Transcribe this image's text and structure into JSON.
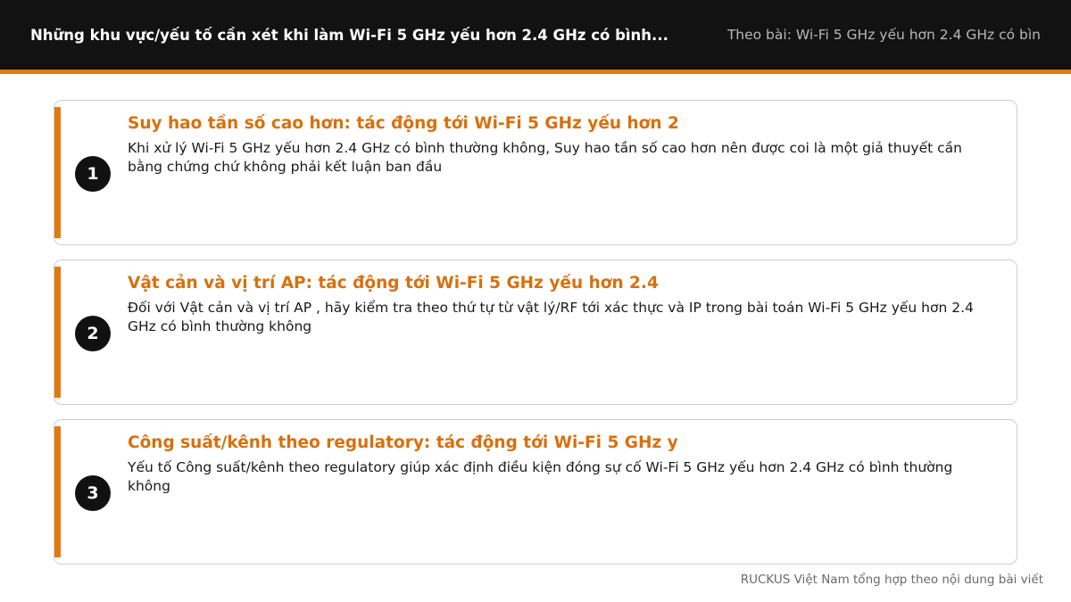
{
  "header": {
    "title": "Những khu vực/yếu tố cần xét khi làm Wi-Fi 5 GHz yếu hơn 2.4 GHz có bình...",
    "source": "Theo bài: Wi-Fi 5 GHz yếu hơn 2.4 GHz có bìn"
  },
  "colors": {
    "accent": "#e07b10",
    "header_bg": "#121212",
    "title_text": "#d8700c"
  },
  "cards": [
    {
      "number": "1",
      "title": "Suy hao tần số cao hơn: tác động tới Wi-Fi 5 GHz yếu hơn 2",
      "description": "Khi xử lý Wi-Fi 5 GHz yếu hơn 2.4 GHz có bình thường không, Suy hao tần số cao hơn nên được coi là một giả thuyết cần bằng chứng chứ không phải kết luận ban đầu"
    },
    {
      "number": "2",
      "title": "Vật cản và vị trí AP: tác động tới Wi-Fi 5 GHz yếu hơn 2.4",
      "description": "Đối với Vật cản và vị trí AP , hãy kiểm tra theo thứ tự từ vật lý/RF tới xác thực và IP trong bài toán Wi-Fi 5 GHz yếu hơn 2.4 GHz có bình thường không"
    },
    {
      "number": "3",
      "title": "Công suất/kênh theo regulatory: tác động tới Wi-Fi 5 GHz y",
      "description": "Yếu tố Công suất/kênh theo regulatory giúp xác định điều kiện đóng sự cố Wi-Fi 5 GHz yếu hơn 2.4 GHz có bình thường không"
    }
  ],
  "footer": {
    "credit": "RUCKUS Việt Nam tổng hợp theo nội dung bài viết"
  }
}
